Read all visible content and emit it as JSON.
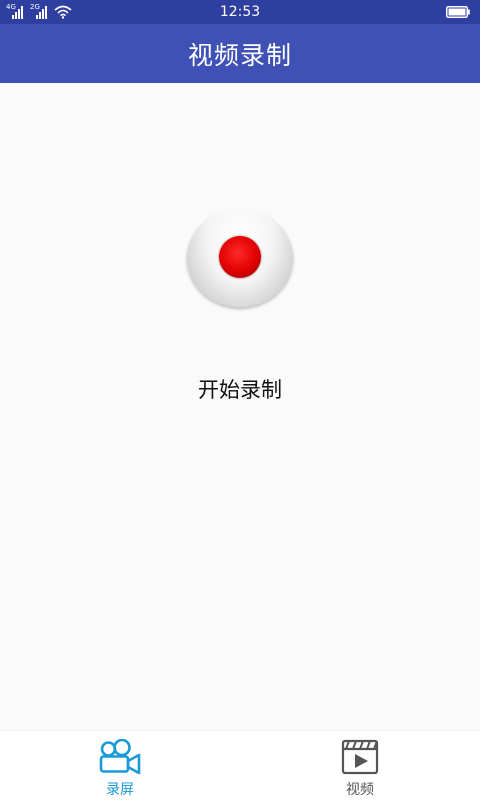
{
  "status_bar": {
    "time": "12:53",
    "signal1_tag": "4G",
    "signal2_tag": "2G",
    "icons": [
      "signal-icon",
      "signal-icon",
      "wifi-icon",
      "battery-icon"
    ]
  },
  "app_bar": {
    "title": "视频录制",
    "color": "#3f51b5",
    "status_color": "#2f3fa0"
  },
  "main": {
    "record_icon": "record-button-icon",
    "record_label": "开始录制"
  },
  "tab_bar": {
    "tabs": [
      {
        "label": "录屏",
        "icon": "video-camera-icon",
        "active": true,
        "color": "#1a9ad6"
      },
      {
        "label": "视频",
        "icon": "video-file-icon",
        "active": false,
        "color": "#555555"
      }
    ]
  }
}
